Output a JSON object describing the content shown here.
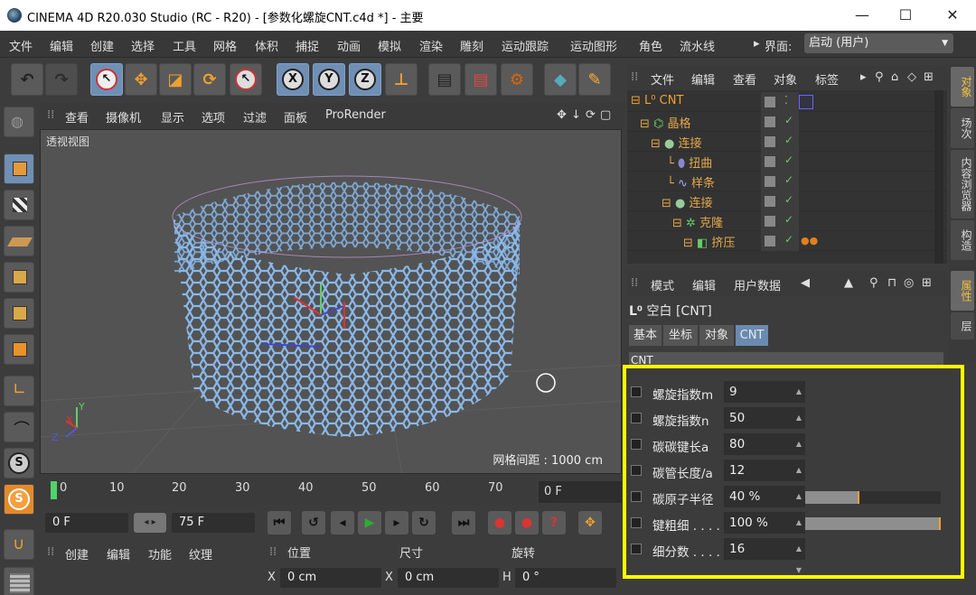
{
  "window": {
    "title": "CINEMA 4D R20.030 Studio (RC - R20) - [参数化螺旋CNT.c4d *] - 主要",
    "min_glyph": "—",
    "max_glyph": "☐",
    "close_glyph": "✕"
  },
  "menu": [
    "文件",
    "编辑",
    "创建",
    "选择",
    "工具",
    "网格",
    "体积",
    "捕捉",
    "动画",
    "模拟",
    "渲染",
    "雕刻",
    "运动跟踪",
    "运动图形",
    "角色",
    "流水线"
  ],
  "layout": {
    "label": "界面:",
    "value": "启动 (用户)"
  },
  "toolbar": {
    "undo_glyph": "↶",
    "redo_glyph": "↷",
    "x_label": "X",
    "y_label": "Y",
    "z_label": "Z"
  },
  "viewport": {
    "menu": [
      "查看",
      "摄像机",
      "显示",
      "选项",
      "过滤",
      "面板",
      "ProRender"
    ],
    "name": "透视视图",
    "grid_label": "网格间距 : 1000 cm",
    "axes": {
      "x": "X",
      "y": "Y",
      "z": "Z"
    }
  },
  "timeline": {
    "ticks": [
      "0",
      "10",
      "20",
      "30",
      "40",
      "50",
      "60",
      "70"
    ],
    "frame": "0 F"
  },
  "transport": {
    "start": "0 F",
    "end": "75 F"
  },
  "material_panel": {
    "tabs": [
      "创建",
      "编辑",
      "功能",
      "纹理"
    ]
  },
  "coord_panel": {
    "headers": [
      "位置",
      "尺寸",
      "旋转"
    ],
    "row": [
      {
        "axis": "X",
        "value": "0 cm"
      },
      {
        "axis": "X",
        "value": "0 cm"
      },
      {
        "axis": "H",
        "value": "0 °"
      }
    ]
  },
  "object_manager": {
    "menu": [
      "文件",
      "编辑",
      "查看",
      "对象",
      "标签"
    ],
    "objects": [
      {
        "name": "CNT",
        "color": "#f0a030"
      },
      {
        "name": "晶格",
        "color": "#e5a84a"
      },
      {
        "name": "连接",
        "color": "#e5a84a"
      },
      {
        "name": "扭曲",
        "color": "#e5a84a"
      },
      {
        "name": "样条",
        "color": "#e5a84a"
      },
      {
        "name": "连接",
        "color": "#e5a84a"
      },
      {
        "name": "克隆",
        "color": "#e5a84a"
      },
      {
        "name": "挤压",
        "color": "#e5a84a"
      }
    ],
    "checkmark": "✓"
  },
  "right_tabs": [
    "对象",
    "场次",
    "内容浏览器",
    "构造",
    "属性",
    "层"
  ],
  "attribute_manager": {
    "menu": [
      "模式",
      "编辑",
      "用户数据"
    ],
    "object_label": "空白 [CNT]",
    "tabs": [
      "基本",
      "坐标",
      "对象",
      "CNT"
    ],
    "section": "CNT",
    "params": [
      {
        "label": "螺旋指数m",
        "value": "9"
      },
      {
        "label": "螺旋指数n",
        "value": "50"
      },
      {
        "label": "碳碳键长a",
        "value": "80"
      },
      {
        "label": "碳管长度/a",
        "value": "12"
      },
      {
        "label": "碳原子半径",
        "value": "40 %",
        "slider": 0.4
      },
      {
        "label": "键粗细 . . . .",
        "value": "100 %",
        "slider": 1.0
      },
      {
        "label": "细分数 . . . .",
        "value": "16"
      }
    ]
  },
  "colors": {
    "highlight": "#ffff00",
    "accent_blue": "#6f8fb5",
    "object_orange": "#e5a84a",
    "nanotube": "#8ab8e8"
  }
}
